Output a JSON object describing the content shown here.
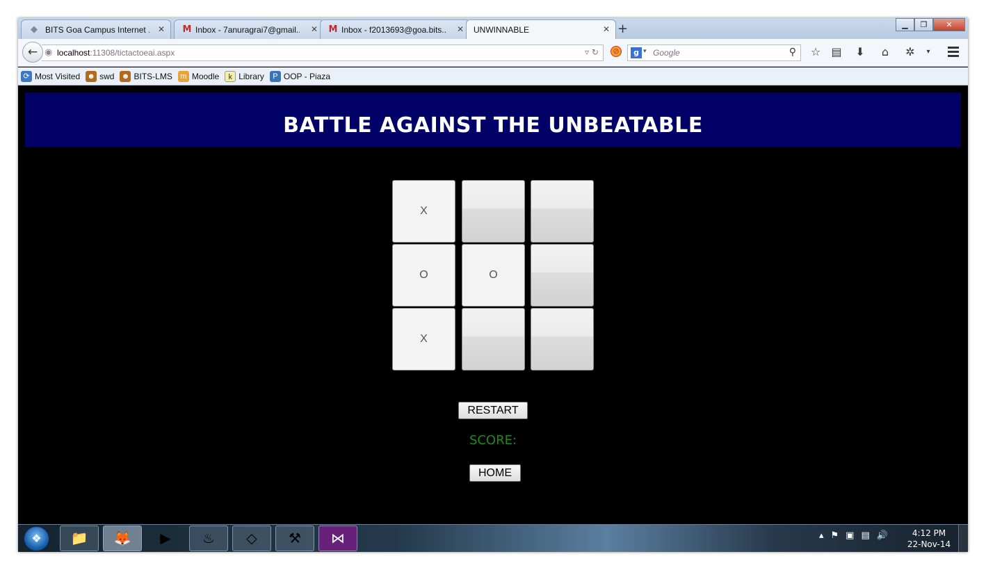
{
  "browser": {
    "tabs": [
      {
        "title": "BITS Goa Campus Internet ...",
        "icon": "bits-icon"
      },
      {
        "title": "Inbox - 7anuragrai7@gmail...",
        "icon": "gmail-icon"
      },
      {
        "title": "Inbox - f2013693@goa.bits...",
        "icon": "gmail-icon"
      },
      {
        "title": "UNWINNABLE",
        "icon": "",
        "active": true
      }
    ],
    "url_host": "localhost",
    "url_rest": ":11308/tictactoeai.aspx",
    "search_placeholder": "Google",
    "bookmarks": [
      "Most Visited",
      "swd",
      "BITS-LMS",
      "Moodle",
      "Library",
      "OOP - Piaza"
    ]
  },
  "page": {
    "title": "BATTLE AGAINST THE UNBEATABLE",
    "board": [
      [
        "X",
        "",
        ""
      ],
      [
        "O",
        "O",
        ""
      ],
      [
        "X",
        "",
        ""
      ]
    ],
    "restart_label": "RESTART",
    "score_label": "SCORE:",
    "home_label": "HOME"
  },
  "taskbar": {
    "time": "4:12 PM",
    "date": "22-Nov-14"
  },
  "colors": {
    "banner": "#000066",
    "score": "#1e8a1e",
    "background": "#000000"
  }
}
